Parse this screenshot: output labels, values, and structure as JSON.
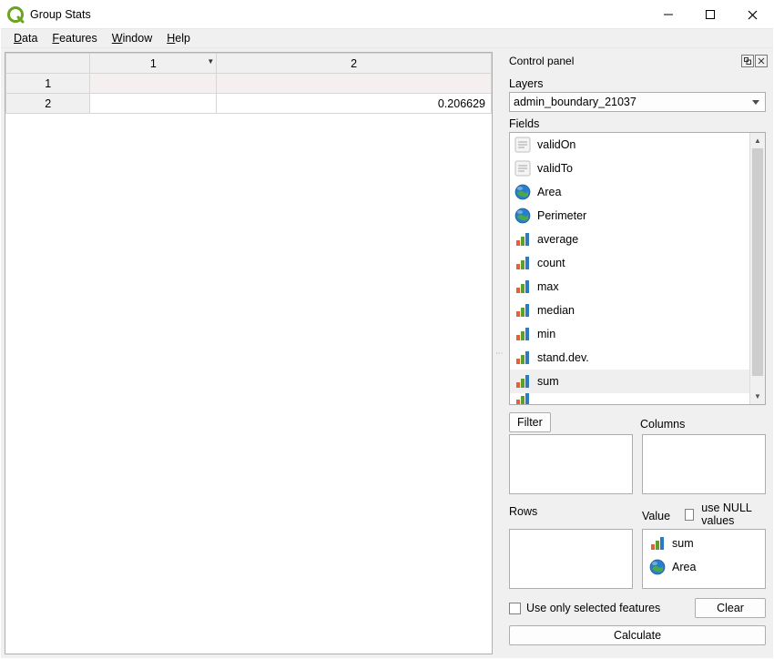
{
  "titlebar": {
    "title": "Group Stats"
  },
  "menubar": {
    "items": [
      "Data",
      "Features",
      "Window",
      "Help"
    ]
  },
  "result_table": {
    "col_headers": [
      "1",
      "2"
    ],
    "row_headers": [
      "1",
      "2"
    ],
    "rows": [
      [
        "",
        ""
      ],
      [
        "",
        "0.206629"
      ]
    ]
  },
  "control_panel": {
    "title": "Control panel",
    "layers_label": "Layers",
    "layer_selected": "admin_boundary_21037",
    "fields_label": "Fields",
    "fields": [
      {
        "name": "validOn",
        "icon": "text"
      },
      {
        "name": "validTo",
        "icon": "text"
      },
      {
        "name": "Area",
        "icon": "globe"
      },
      {
        "name": "Perimeter",
        "icon": "globe"
      },
      {
        "name": "average",
        "icon": "bars"
      },
      {
        "name": "count",
        "icon": "bars"
      },
      {
        "name": "max",
        "icon": "bars"
      },
      {
        "name": "median",
        "icon": "bars"
      },
      {
        "name": "min",
        "icon": "bars"
      },
      {
        "name": "stand.dev.",
        "icon": "bars"
      },
      {
        "name": "sum",
        "icon": "bars",
        "selected": true
      }
    ],
    "filter_label": "Filter",
    "columns_label": "Columns",
    "rows_label": "Rows",
    "value_label": "Value",
    "use_null_label": "use NULL values",
    "value_items": [
      {
        "name": "sum",
        "icon": "bars"
      },
      {
        "name": "Area",
        "icon": "globe"
      }
    ],
    "use_only_selected_label": "Use only selected features",
    "clear_label": "Clear",
    "calculate_label": "Calculate"
  }
}
